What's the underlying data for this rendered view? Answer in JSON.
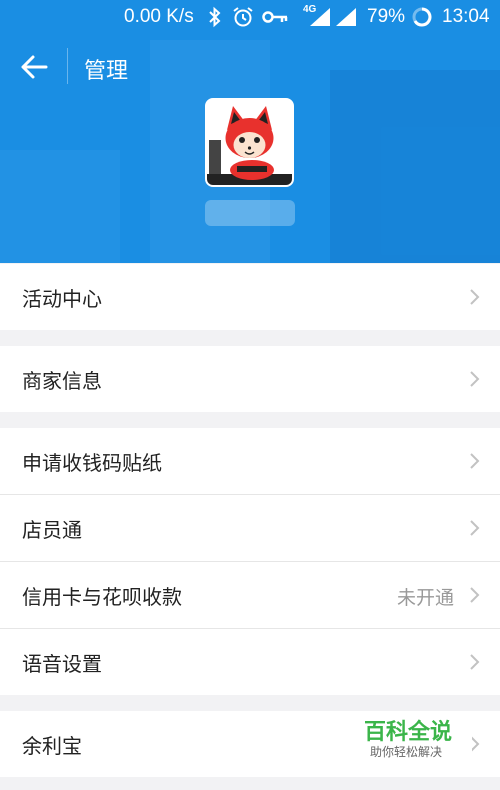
{
  "status_bar": {
    "net_speed": "0.00 K/s",
    "network_type": "4G",
    "battery": "79%",
    "time": "13:04",
    "icons": [
      "bluetooth-icon",
      "alarm-icon",
      "key-icon",
      "signal-icon",
      "battery-icon"
    ]
  },
  "header": {
    "title": "管理",
    "background_color": "#1a8ee3"
  },
  "menu": {
    "group1": [
      {
        "label": "活动中心"
      }
    ],
    "group2": [
      {
        "label": "商家信息"
      }
    ],
    "group3": [
      {
        "label": "申请收钱码贴纸"
      },
      {
        "label": "店员通"
      },
      {
        "label": "信用卡与花呗收款",
        "value": "未开通"
      },
      {
        "label": "语音设置"
      }
    ],
    "group4": [
      {
        "label": "余利宝"
      }
    ]
  },
  "watermark": {
    "title": "百科全说",
    "subtitle": "助你轻松解决"
  }
}
